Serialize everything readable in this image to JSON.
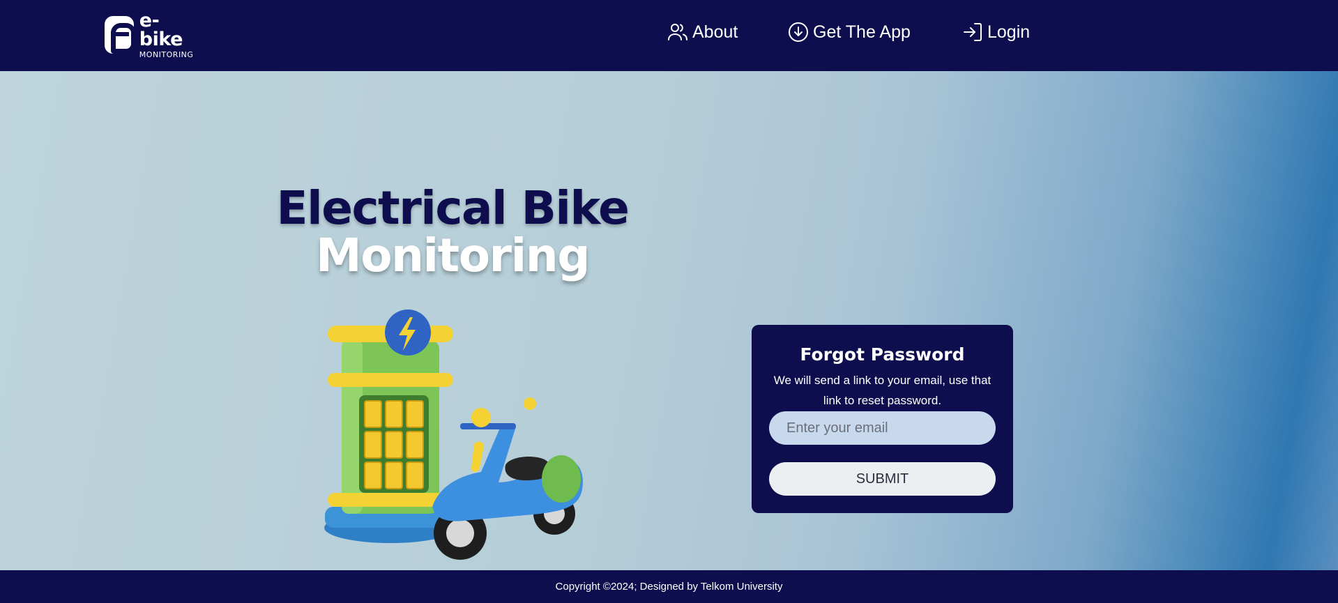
{
  "brand": {
    "name": "e-bike",
    "subtitle": "MONITORING"
  },
  "nav": {
    "items": [
      {
        "label": "About",
        "icon": "users-icon"
      },
      {
        "label": "Get The App",
        "icon": "download-circle-icon"
      },
      {
        "label": "Login",
        "icon": "login-arrow-icon"
      }
    ]
  },
  "hero": {
    "title_line1": "Electrical Bike",
    "title_line2": "Monitoring",
    "illustration": "charging-station-and-scooter"
  },
  "forgot_password": {
    "title": "Forgot Password",
    "description": "We will send a link to your email, use that link to reset password.",
    "email_placeholder": "Enter your email",
    "email_value": "",
    "submit_label": "SUBMIT"
  },
  "footer": {
    "copyright": "Copyright ©2024; Designed by Telkom University"
  },
  "colors": {
    "navy": "#0e0e4f",
    "input_bg": "#c8d9ee",
    "button_bg": "#eceff2"
  }
}
